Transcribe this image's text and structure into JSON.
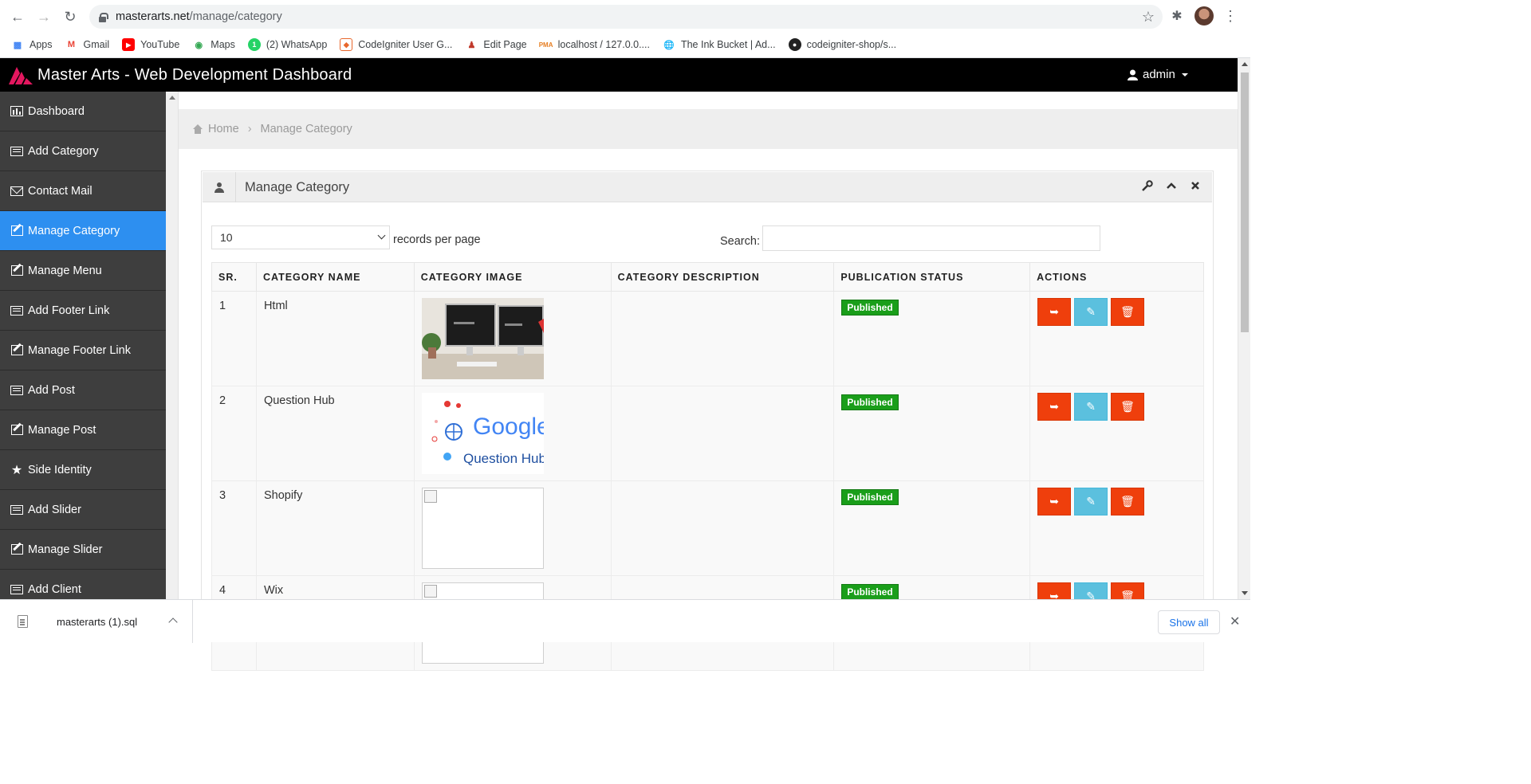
{
  "browser": {
    "url_domain": "masterarts.net",
    "url_path": "/manage/category",
    "bookmarks": [
      {
        "label": "Apps",
        "icon": "apps-grid-icon"
      },
      {
        "label": "Gmail",
        "icon": "gmail-icon"
      },
      {
        "label": "YouTube",
        "icon": "youtube-icon"
      },
      {
        "label": "Maps",
        "icon": "maps-icon"
      },
      {
        "label": "(2) WhatsApp",
        "icon": "whatsapp-icon"
      },
      {
        "label": "CodeIgniter User G...",
        "icon": "codeigniter-icon"
      },
      {
        "label": "Edit Page",
        "icon": "edit-page-icon"
      },
      {
        "label": "localhost / 127.0.0....",
        "icon": "phpmyadmin-icon"
      },
      {
        "label": "The Ink Bucket | Ad...",
        "icon": "globe-icon"
      },
      {
        "label": "codeigniter-shop/s...",
        "icon": "github-icon"
      }
    ]
  },
  "app": {
    "brand": "Master Arts - Web Development Dashboard",
    "user": "admin",
    "colors": {
      "header": "#000000",
      "sidebar": "#3e3e3e",
      "active": "#2d8ff0",
      "badge": "#1a9e1a",
      "danger": "#ef3f0c",
      "info": "#5bc0de"
    }
  },
  "sidebar": {
    "items": [
      {
        "label": "Dashboard",
        "icon": "bar-chart-icon"
      },
      {
        "label": "Add Category",
        "icon": "list-icon"
      },
      {
        "label": "Contact Mail",
        "icon": "envelope-icon"
      },
      {
        "label": "Manage Category",
        "icon": "edit-icon",
        "active": true
      },
      {
        "label": "Manage Menu",
        "icon": "edit-icon"
      },
      {
        "label": "Add Footer Link",
        "icon": "list-icon"
      },
      {
        "label": "Manage Footer Link",
        "icon": "edit-icon"
      },
      {
        "label": "Add Post",
        "icon": "list-icon"
      },
      {
        "label": "Manage Post",
        "icon": "edit-icon"
      },
      {
        "label": "Side Identity",
        "icon": "star-icon"
      },
      {
        "label": "Add Slider",
        "icon": "list-icon"
      },
      {
        "label": "Manage Slider",
        "icon": "edit-icon"
      },
      {
        "label": "Add Client",
        "icon": "list-icon"
      }
    ]
  },
  "breadcrumb": {
    "home": "Home",
    "current": "Manage Category"
  },
  "panel": {
    "title": "Manage Category",
    "length_value": "10",
    "length_label": "records per page",
    "search_label": "Search:",
    "search_value": "",
    "columns": [
      "SR.",
      "CATEGORY NAME",
      "CATEGORY IMAGE",
      "CATEGORY DESCRIPTION",
      "PUBLICATION STATUS",
      "ACTIONS"
    ],
    "rows": [
      {
        "sr": "1",
        "name": "Html",
        "image": "desk-monitors",
        "description": "",
        "status": "Published"
      },
      {
        "sr": "2",
        "name": "Question Hub",
        "image": "google-question-hub",
        "description": "",
        "status": "Published"
      },
      {
        "sr": "3",
        "name": "Shopify",
        "image": "broken",
        "description": "",
        "status": "Published"
      },
      {
        "sr": "4",
        "name": "Wix",
        "image": "broken",
        "description": "",
        "status": "Published"
      }
    ],
    "image_text": {
      "google": "Google",
      "question_hub": "Question Hub"
    }
  },
  "downloads": {
    "file": "masterarts (1).sql",
    "show_all": "Show all"
  }
}
